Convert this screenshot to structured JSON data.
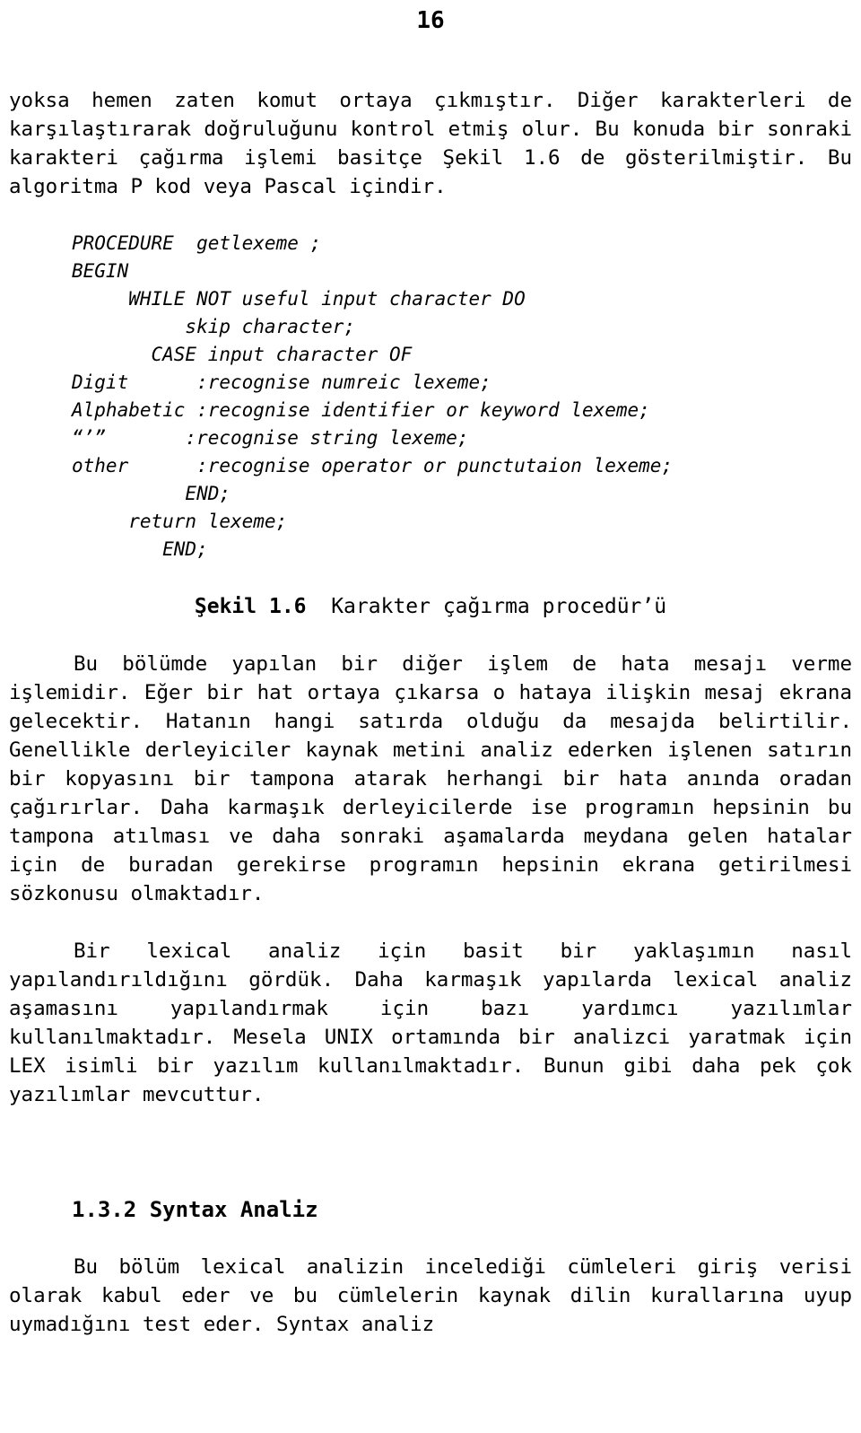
{
  "page": {
    "number": "16"
  },
  "body": {
    "para1": "yoksa hemen zaten komut ortaya çıkmıştır. Diğer karakterleri de karşılaştırarak doğruluğunu kontrol etmiş olur. Bu konuda bir sonraki karakteri çağırma işlemi basitçe Şekil 1.6 de gösterilmiştir. Bu algoritma P kod veya Pascal içindir.",
    "code": "PROCEDURE  getlexeme ;\nBEGIN\n     WHILE NOT useful input character DO\n          skip character;\n       CASE input character OF\nDigit      :recognise numreic lexeme;\nAlphabetic :recognise identifier or keyword lexeme;\n“’”       :recognise string lexeme;\nother      :recognise operator or punctutaion lexeme;\n          END;\n     return lexeme;\n        END;",
    "figure_caption_bold": "Şekil 1.6",
    "figure_caption_rest": "  Karakter çağırma procedür’ü",
    "para2": "Bu bölümde yapılan bir diğer işlem de hata mesajı verme işlemidir. Eğer bir hat ortaya çıkarsa o hataya ilişkin mesaj ekrana gelecektir. Hatanın hangi satırda olduğu da mesajda belirtilir. Genellikle derleyiciler kaynak metini analiz ederken işlenen satırın bir kopyasını bir tampona atarak herhangi bir hata anında oradan çağırırlar. Daha karmaşık derleyicilerde ise programın hepsinin bu tampona atılması ve daha sonraki aşamalarda meydana gelen hatalar için de buradan gerekirse programın hepsinin ekrana getirilmesi sözkonusu olmaktadır.",
    "para3": "Bir lexical analiz için basit bir yaklaşımın nasıl yapılandırıldığını gördük. Daha karmaşık yapılarda lexical analiz aşamasını yapılandırmak için bazı yardımcı yazılımlar kullanılmaktadır. Mesela UNIX ortamında bir analizci yaratmak için LEX isimli bir yazılım kullanılmaktadır. Bunun gibi daha pek çok yazılımlar mevcuttur.",
    "section_heading": "1.3.2 Syntax Analiz",
    "para4": "Bu bölüm lexical analizin incelediği cümleleri giriş verisi olarak kabul eder ve bu cümlelerin kaynak dilin kurallarına uyup uymadığını test eder. Syntax analiz"
  }
}
